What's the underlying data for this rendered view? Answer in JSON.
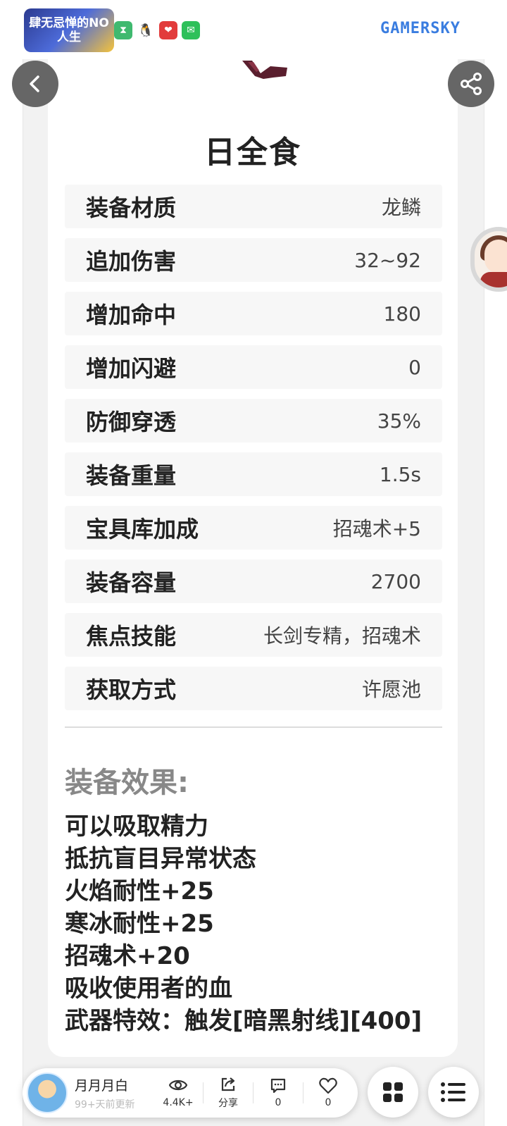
{
  "header": {
    "logo_text": "肆无忌惮的NO人生",
    "brand_text": "GAMERSKY"
  },
  "item": {
    "title": "日全食",
    "attributes": [
      {
        "label": "装备材质",
        "value": "龙鳞"
      },
      {
        "label": "追加伤害",
        "value": "32~92"
      },
      {
        "label": "增加命中",
        "value": "180"
      },
      {
        "label": "增加闪避",
        "value": "0"
      },
      {
        "label": "防御穿透",
        "value": "35%"
      },
      {
        "label": "装备重量",
        "value": "1.5s"
      },
      {
        "label": "宝具库加成",
        "value": "招魂术+5"
      },
      {
        "label": "装备容量",
        "value": "2700"
      },
      {
        "label": "焦点技能",
        "value": "长剑专精，招魂术"
      },
      {
        "label": "获取方式",
        "value": "许愿池"
      }
    ],
    "effect_title": "装备效果:",
    "effects": [
      "可以吸取精力",
      "抵抗盲目异常状态",
      "火焰耐性+25",
      "寒冰耐性+25",
      "招魂术+20",
      "吸收使用者的血",
      "武器特效：触发[暗黑射线][400]"
    ]
  },
  "bottom_bar": {
    "author": "月月月白",
    "updated": "99+天前更新",
    "views": "4.4K+",
    "share_label": "分享",
    "comments": "0",
    "likes": "0"
  },
  "icons": {
    "back": "chevron-left-icon",
    "share": "share-icon",
    "views": "eye-icon",
    "share_action": "share-arrow-icon",
    "comments": "comment-icon",
    "likes": "heart-icon",
    "apps": "apps-grid-icon",
    "menu": "list-menu-icon"
  }
}
